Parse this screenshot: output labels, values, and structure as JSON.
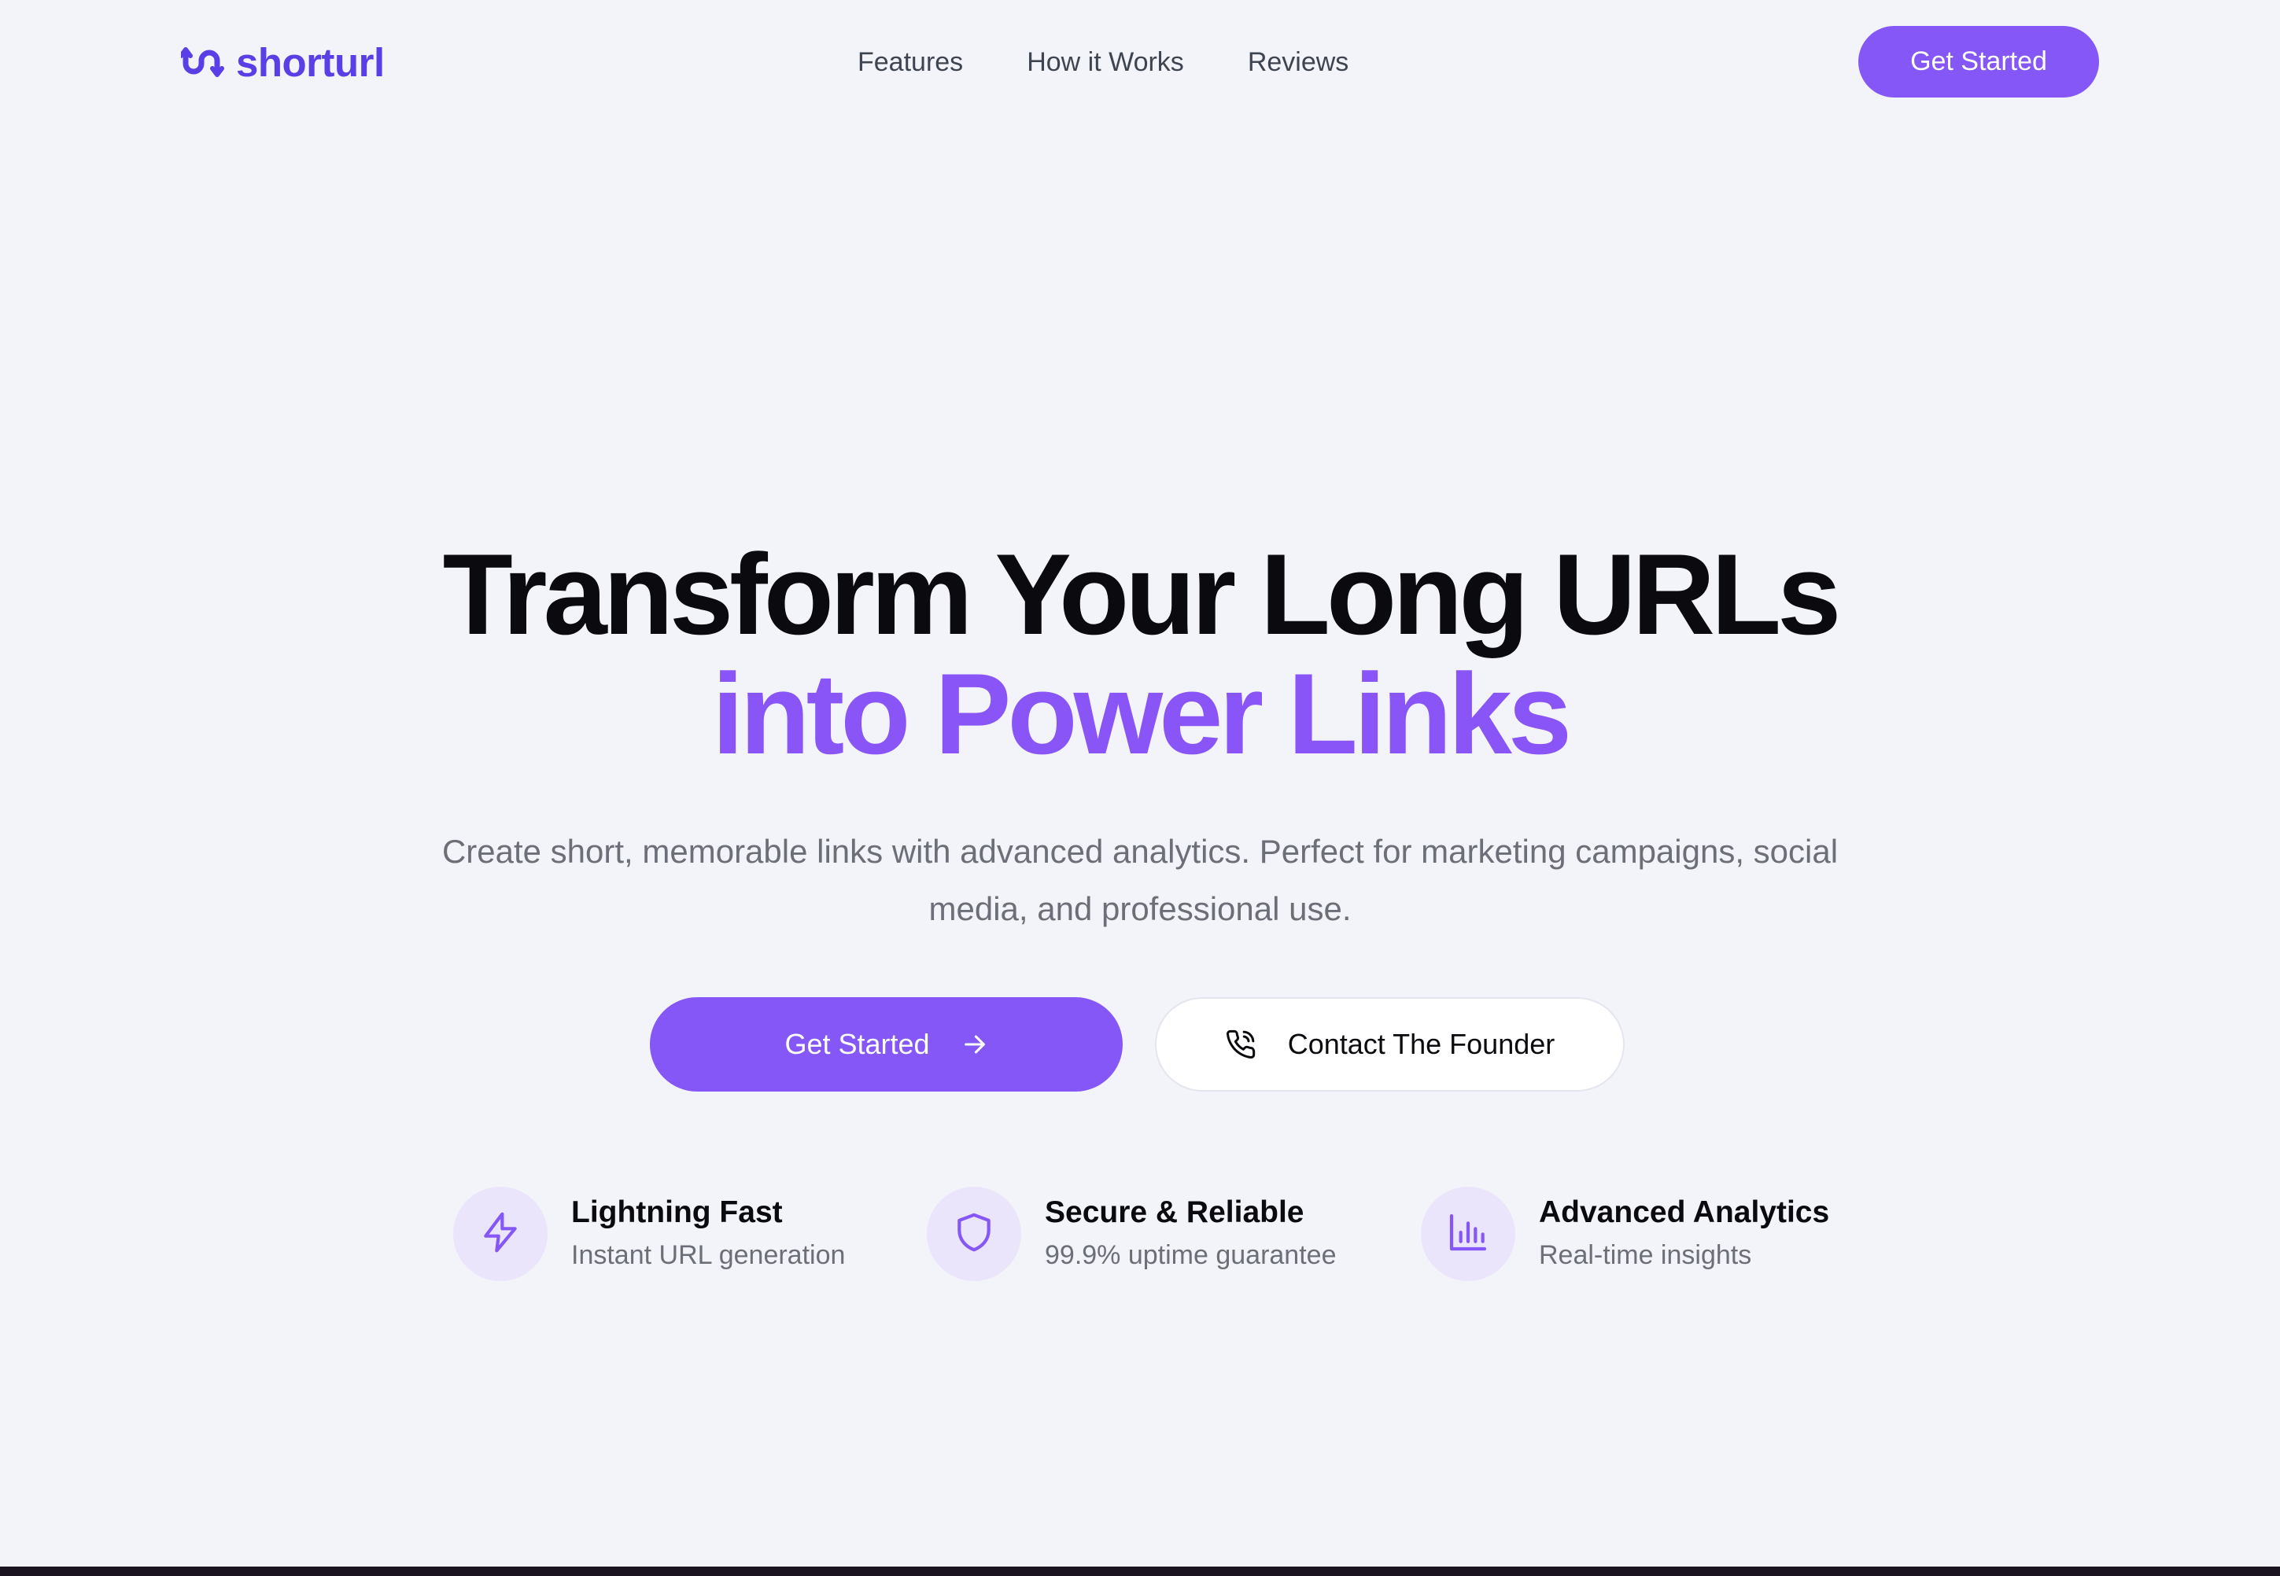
{
  "brand": {
    "name": "shorturl",
    "logo_icon": "link-loop-icon",
    "color": "#5a3ee6"
  },
  "nav": {
    "links": [
      {
        "label": "Features"
      },
      {
        "label": "How it Works"
      },
      {
        "label": "Reviews"
      }
    ],
    "cta_label": "Get Started"
  },
  "hero": {
    "title_line1": "Transform Your Long URLs",
    "title_line2": "into Power Links",
    "subtitle": "Create short, memorable links with advanced analytics. Perfect for marketing campaigns, social media, and professional use.",
    "primary_cta": {
      "label": "Get Started",
      "icon": "arrow-right-icon"
    },
    "secondary_cta": {
      "label": "Contact The Founder",
      "icon": "phone-icon"
    }
  },
  "features": [
    {
      "icon": "lightning-icon",
      "title": "Lightning Fast",
      "description": "Instant URL generation"
    },
    {
      "icon": "shield-icon",
      "title": "Secure & Reliable",
      "description": "99.9% uptime guarantee"
    },
    {
      "icon": "bar-chart-icon",
      "title": "Advanced Analytics",
      "description": "Real-time insights"
    }
  ],
  "colors": {
    "accent": "#8557f7",
    "accent_text": "#8a55f6",
    "background": "#f2f4f9",
    "icon_bg": "#ebe5fb"
  }
}
